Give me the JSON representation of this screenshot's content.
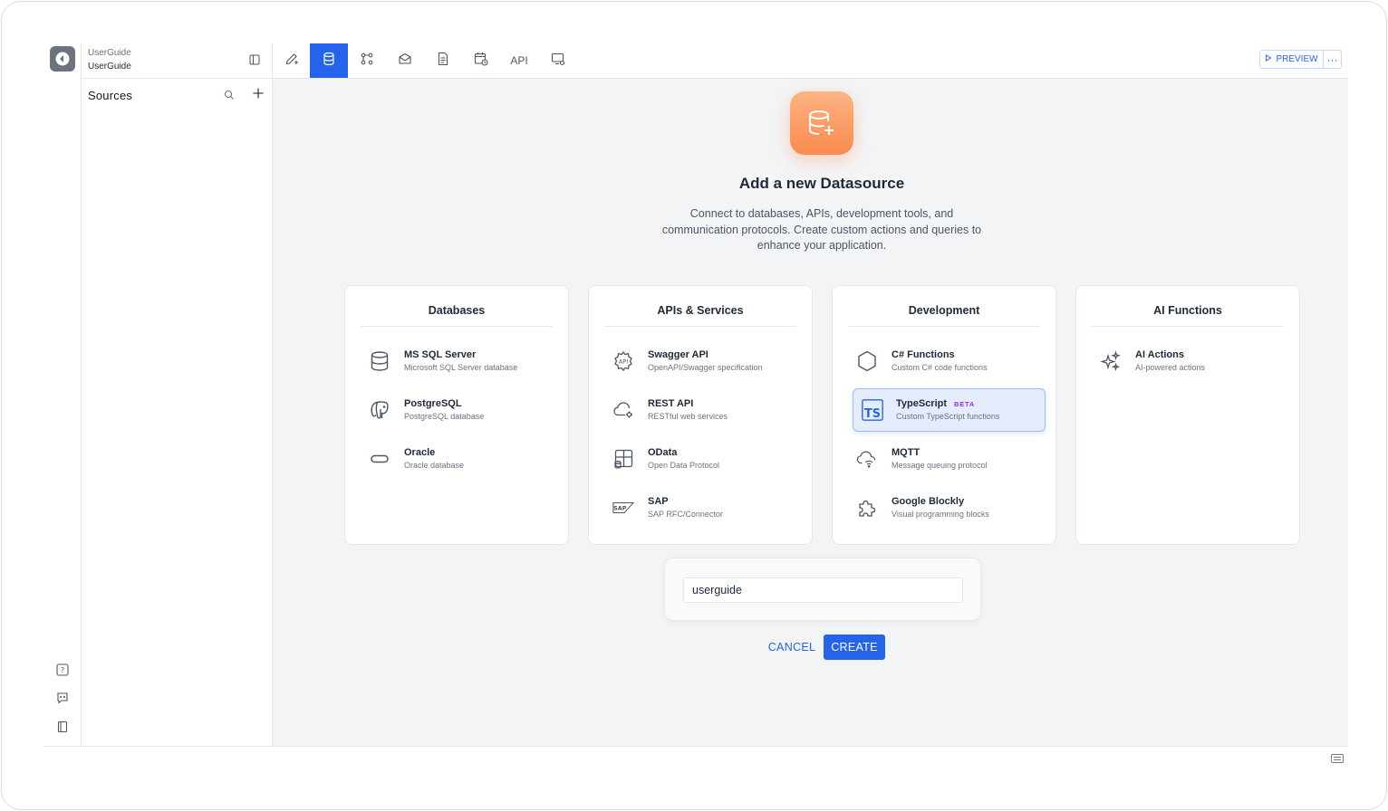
{
  "app": {
    "name_primary": "UserGuide",
    "name_secondary": "UserGuide"
  },
  "sidebar": {
    "title": "Sources"
  },
  "toolbar": {
    "tabs": [
      {
        "icon": "pencil-plus-icon",
        "active": false
      },
      {
        "icon": "database-icon",
        "active": true
      },
      {
        "icon": "flow-icon",
        "active": false
      },
      {
        "icon": "mail-icon",
        "active": false
      },
      {
        "icon": "document-icon",
        "active": false
      },
      {
        "icon": "calendar-clock-icon",
        "active": false
      },
      {
        "label": "API",
        "active": false
      },
      {
        "icon": "monitor-settings-icon",
        "active": false
      }
    ],
    "preview_label": "PREVIEW",
    "more_label": "···"
  },
  "hero": {
    "title": "Add a new Datasource",
    "subtitle": "Connect to databases, APIs, development tools, and communication protocols. Create custom actions and queries to enhance your application."
  },
  "categories": [
    {
      "title": "Databases",
      "items": [
        {
          "name": "MS SQL Server",
          "desc": "Microsoft SQL Server database",
          "icon": "database-icon"
        },
        {
          "name": "PostgreSQL",
          "desc": "PostgreSQL database",
          "icon": "postgresql-elephant-icon"
        },
        {
          "name": "Oracle",
          "desc": "Oracle database",
          "icon": "oracle-icon"
        }
      ]
    },
    {
      "title": "APIs & Services",
      "items": [
        {
          "name": "Swagger API",
          "desc": "OpenAPI/Swagger specification",
          "icon": "api-gear-icon"
        },
        {
          "name": "REST API",
          "desc": "RESTful web services",
          "icon": "cloud-gear-icon"
        },
        {
          "name": "OData",
          "desc": "Open Data Protocol",
          "icon": "odata-table-icon"
        },
        {
          "name": "SAP",
          "desc": "SAP RFC/Connector",
          "icon": "sap-logo-icon"
        }
      ]
    },
    {
      "title": "Development",
      "items": [
        {
          "name": "C# Functions",
          "desc": "Custom C# code functions",
          "icon": "hexagon-icon"
        },
        {
          "name": "TypeScript",
          "desc": "Custom TypeScript functions",
          "icon": "typescript-icon",
          "badge": "BETA",
          "selected": true
        },
        {
          "name": "MQTT",
          "desc": "Message queuing protocol",
          "icon": "cloud-signal-icon"
        },
        {
          "name": "Google Blockly",
          "desc": "Visual programming blocks",
          "icon": "puzzle-icon"
        }
      ]
    },
    {
      "title": "AI Functions",
      "items": [
        {
          "name": "AI Actions",
          "desc": "AI-powered actions",
          "icon": "sparkles-icon"
        }
      ]
    }
  ],
  "form": {
    "name_value": "userguide",
    "cancel_label": "CANCEL",
    "create_label": "CREATE"
  },
  "colors": {
    "accent": "#2563eb",
    "hero_gradient_top": "#fdb383",
    "hero_gradient_bottom": "#f98b4e",
    "beta": "#9333ea"
  }
}
